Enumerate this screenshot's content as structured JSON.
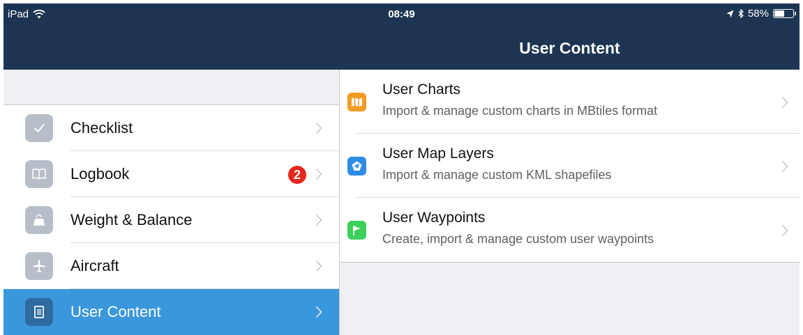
{
  "status_bar": {
    "device": "iPad",
    "time": "08:49",
    "battery": "58%",
    "battery_level": 0.58
  },
  "nav": {
    "title": "User Content"
  },
  "sidebar": {
    "items": [
      {
        "label": "Checklist",
        "icon": "checkmark-icon"
      },
      {
        "label": "Logbook",
        "icon": "book-icon",
        "badge": "2"
      },
      {
        "label": "Weight & Balance",
        "icon": "weight-icon"
      },
      {
        "label": "Aircraft",
        "icon": "airplane-icon"
      },
      {
        "label": "User Content",
        "icon": "document-icon",
        "selected": true
      }
    ]
  },
  "detail": {
    "items": [
      {
        "title": "User Charts",
        "subtitle": "Import & manage custom charts in MBtiles format",
        "icon": "map-icon",
        "icon_color": "#f59a23"
      },
      {
        "title": "User Map Layers",
        "subtitle": "Import & manage custom KML shapefiles",
        "icon": "layers-icon",
        "icon_color": "#2f8ce6"
      },
      {
        "title": "User Waypoints",
        "subtitle": "Create, import & manage custom user waypoints",
        "icon": "flag-icon",
        "icon_color": "#3ccf5a"
      }
    ]
  },
  "colors": {
    "nav_bar": "#1d3553",
    "selected": "#3a97dc",
    "badge": "#e8261c"
  }
}
